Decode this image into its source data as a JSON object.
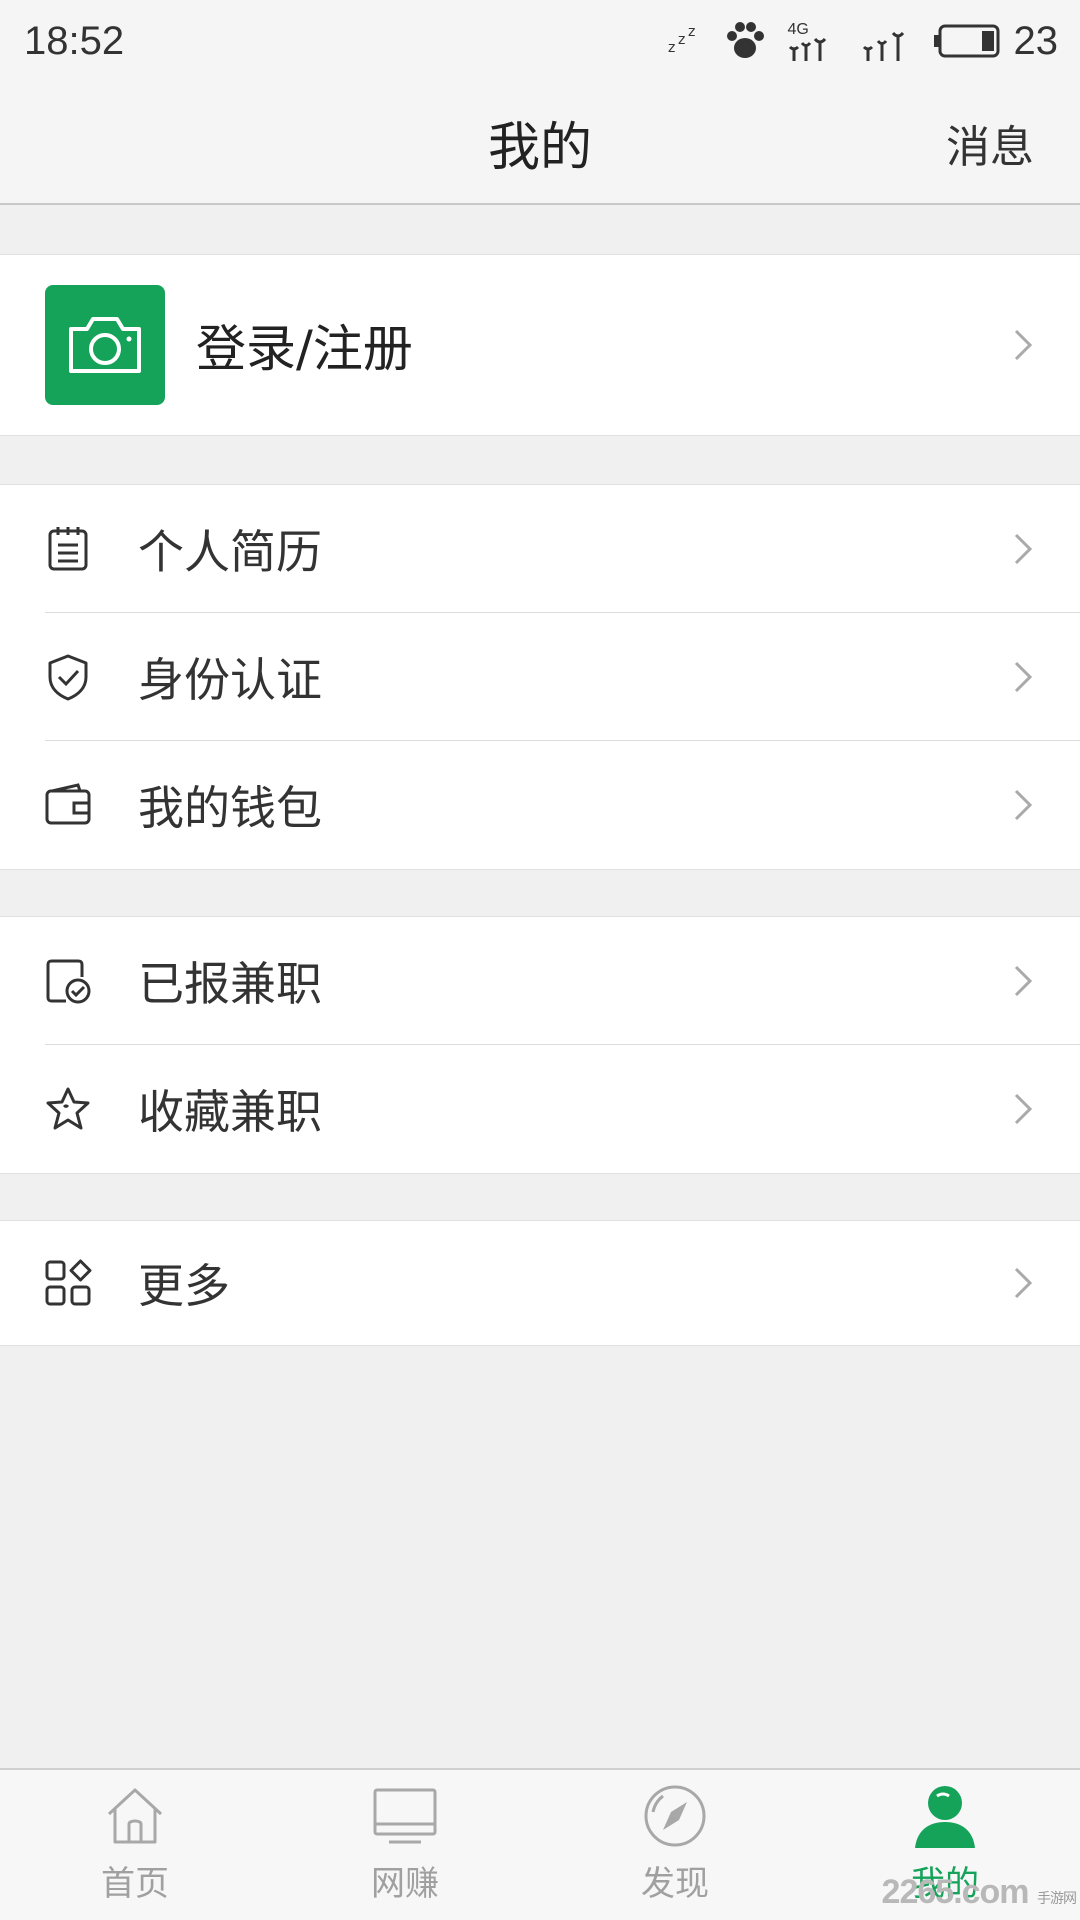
{
  "status_bar": {
    "time": "18:52",
    "network": "4G",
    "battery_level": "23",
    "icons": [
      "sleep-icon",
      "paw-icon",
      "signal-icon",
      "signal-icon",
      "battery-icon"
    ]
  },
  "nav": {
    "title": "我的",
    "action": "消息"
  },
  "profile": {
    "login_label": "登录/注册",
    "avatar_icon": "camera-icon",
    "avatar_color": "#15a35a"
  },
  "menu_group_1": [
    {
      "label": "个人简历",
      "icon": "resume-icon"
    },
    {
      "label": "身份认证",
      "icon": "shield-icon"
    },
    {
      "label": "我的钱包",
      "icon": "wallet-icon"
    }
  ],
  "menu_group_2": [
    {
      "label": "已报兼职",
      "icon": "applied-icon"
    },
    {
      "label": "收藏兼职",
      "icon": "star-icon"
    }
  ],
  "menu_group_3": [
    {
      "label": "更多",
      "icon": "apps-icon"
    }
  ],
  "tabs": [
    {
      "label": "首页",
      "icon": "home-icon",
      "active": false
    },
    {
      "label": "网赚",
      "icon": "monitor-icon",
      "active": false
    },
    {
      "label": "发现",
      "icon": "compass-icon",
      "active": false
    },
    {
      "label": "我的",
      "icon": "user-icon",
      "active": true
    }
  ],
  "watermark": {
    "text": "2265",
    "suffix": ".com",
    "small": "手游网"
  },
  "colors": {
    "accent": "#15a35a",
    "background": "#f0f0f0"
  }
}
